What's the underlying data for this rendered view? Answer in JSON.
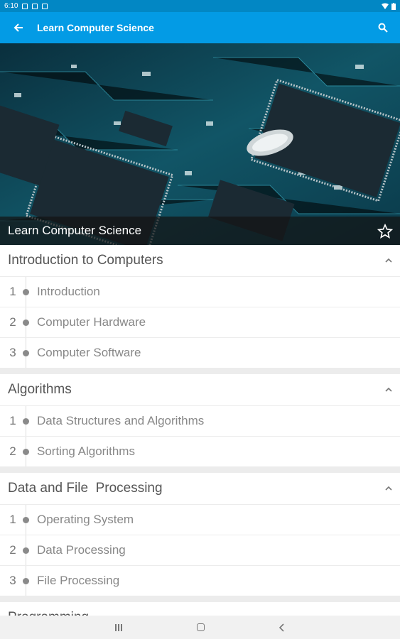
{
  "status_bar": {
    "time": "6:10"
  },
  "app_bar": {
    "title": "Learn Computer Science",
    "back_icon": "arrow-back-icon",
    "search_icon": "search-icon"
  },
  "hero": {
    "caption": "Learn Computer Science",
    "image": "circuit-board-photo",
    "star_icon": "star-outline-icon"
  },
  "sections": [
    {
      "title": "Introduction to Computers",
      "items": [
        {
          "num": "1",
          "label": "Introduction"
        },
        {
          "num": "2",
          "label": "Computer Hardware"
        },
        {
          "num": "3",
          "label": "Computer Software"
        }
      ]
    },
    {
      "title": "Algorithms",
      "items": [
        {
          "num": "1",
          "label": "Data Structures and Algorithms"
        },
        {
          "num": "2",
          "label": "Sorting Algorithms"
        }
      ]
    },
    {
      "title": "Data and File  Processing",
      "items": [
        {
          "num": "1",
          "label": "Operating System"
        },
        {
          "num": "2",
          "label": "Data Processing"
        },
        {
          "num": "3",
          "label": "File Processing"
        }
      ]
    },
    {
      "title": "Programming",
      "items": []
    }
  ],
  "colors": {
    "status_bar": "#0287c4",
    "app_bar": "#039be5"
  }
}
